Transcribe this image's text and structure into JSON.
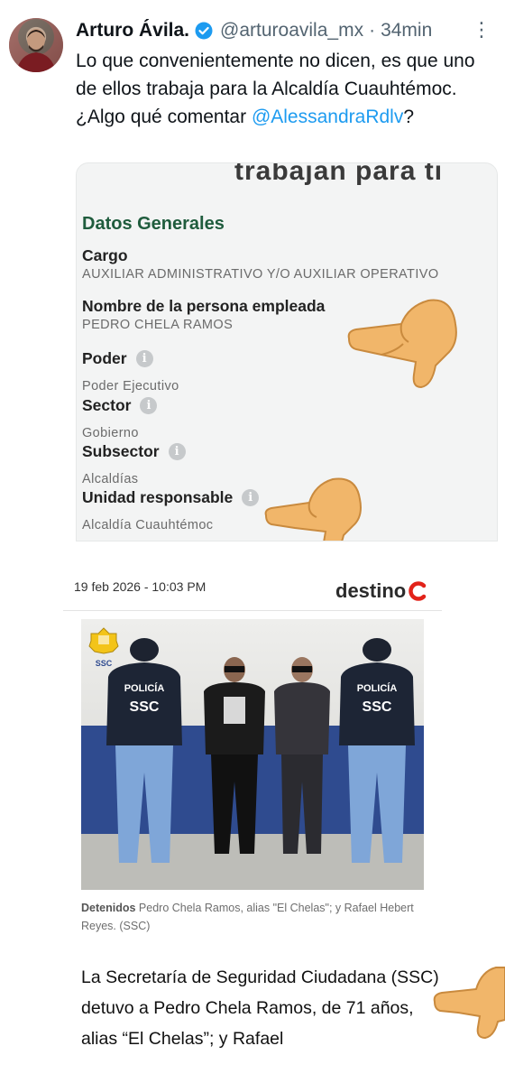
{
  "tweet": {
    "author_name": "Arturo Ávila.",
    "handle": "@arturoavila_mx",
    "separator": "·",
    "time": "34min",
    "more": "⋮",
    "text_line1": "Lo que convenientemente no dicen, es que uno de ellos trabaja para la Alcaldía Cuauhtémoc.",
    "text_line2_prefix": "¿Algo qué comentar ",
    "mention": "@AlessandraRdlv",
    "text_line2_suffix": "?"
  },
  "card": {
    "cut_heading": "trabajan para ti",
    "section_title": "Datos Generales",
    "fields": [
      {
        "label": "Cargo",
        "value": "AUXILIAR ADMINISTRATIVO Y/O AUXILIAR OPERATIVO"
      },
      {
        "label": "Nombre de la persona empleada",
        "value": "PEDRO CHELA RAMOS"
      },
      {
        "label": "Poder",
        "value": "Poder Ejecutivo"
      },
      {
        "label": "Sector",
        "value": "Gobierno"
      },
      {
        "label": "Subsector",
        "value": "Alcaldías"
      },
      {
        "label": "Unidad responsable",
        "value": "Alcaldía Cuauhtémoc"
      }
    ],
    "info_glyph": "i"
  },
  "article": {
    "date": "19 feb 2026 - 10:03 PM",
    "brand": "destino",
    "photo_logo_text": "SSC",
    "vest_text_1": "POLICÍA",
    "vest_text_2": "SSC",
    "caption_bold": "Detenidos",
    "caption_rest": " Pedro Chela Ramos, alias \"El Chelas\"; y Rafael Hebert Reyes. (SSC)",
    "body": "La Secretaría de Seguridad Ciudadana (SSC) detuvo a Pedro Chela Ramos, de 71 años, alias “El Chelas”; y Rafael"
  },
  "colors": {
    "mention": "#1d9bf0",
    "section_title": "#1f5c3d",
    "brand_red": "#e2231a",
    "police_blue": "#2f4b8f"
  },
  "icons": [
    "verified-badge-icon",
    "more-options-icon",
    "info-icon",
    "thumbs-down-pointing-hand-icon",
    "destino-logo-icon",
    "ssc-shield-icon"
  ]
}
